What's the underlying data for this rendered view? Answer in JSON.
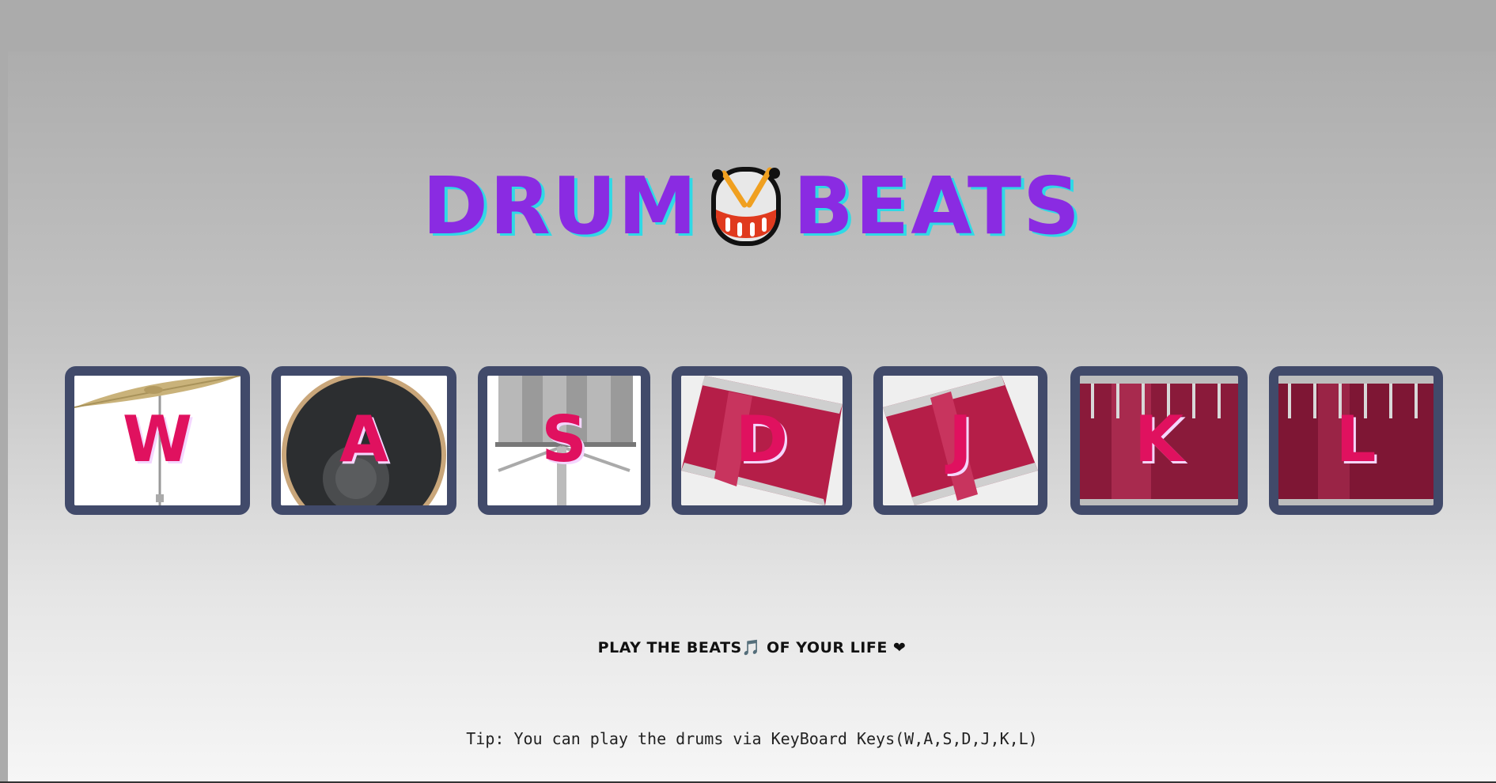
{
  "title": {
    "left_word": "DRUM",
    "right_word": "BEATS"
  },
  "drums": [
    {
      "key": "W",
      "kind": "crash-cymbal"
    },
    {
      "key": "A",
      "kind": "kick-drum"
    },
    {
      "key": "S",
      "kind": "snare"
    },
    {
      "key": "D",
      "kind": "tom-1"
    },
    {
      "key": "J",
      "kind": "tom-2"
    },
    {
      "key": "K",
      "kind": "tom-3"
    },
    {
      "key": "L",
      "kind": "tom-4"
    }
  ],
  "tagline": "PLAY THE BEATS🎵 OF YOUR LIFE ❤",
  "tip": "Tip: You can play the drums via KeyBoard Keys(W,A,S,D,J,K,L)",
  "colors": {
    "title": "#8a2be2",
    "title_shadow": "#2fd9e6",
    "key_letter": "#e0115f",
    "drum_border": "#414a6a"
  }
}
